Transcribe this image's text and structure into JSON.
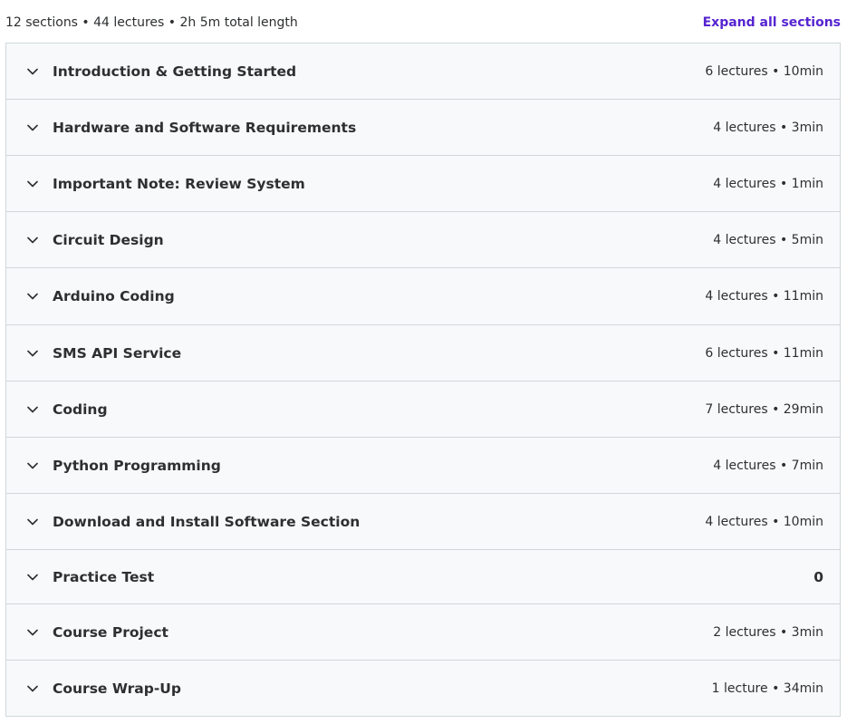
{
  "summary": {
    "text": "12 sections • 44 lectures • 2h 5m total length",
    "expand_label": "Expand all sections"
  },
  "colors": {
    "accent": "#5624d0",
    "section_bg": "#f7f9fa",
    "border": "#d1d7dc",
    "text": "#2d2f31"
  },
  "icons": {
    "section_toggle": "chevron-down-icon"
  },
  "sections": [
    {
      "title": "Introduction & Getting Started",
      "meta": "6 lectures • 10min"
    },
    {
      "title": "Hardware and Software Requirements",
      "meta": "4 lectures • 3min"
    },
    {
      "title": "Important Note: Review System",
      "meta": "4 lectures • 1min"
    },
    {
      "title": "Circuit Design",
      "meta": "4 lectures • 5min"
    },
    {
      "title": "Arduino Coding",
      "meta": "4 lectures • 11min"
    },
    {
      "title": "SMS API Service",
      "meta": "6 lectures • 11min"
    },
    {
      "title": "Coding",
      "meta": "7 lectures • 29min"
    },
    {
      "title": "Python Programming",
      "meta": "4 lectures • 7min"
    },
    {
      "title": "Download and Install Software Section",
      "meta": "4 lectures • 10min"
    },
    {
      "title": "Practice Test",
      "meta": "0"
    },
    {
      "title": "Course Project",
      "meta": "2 lectures • 3min"
    },
    {
      "title": "Course Wrap-Up",
      "meta": "1 lecture • 34min"
    }
  ]
}
